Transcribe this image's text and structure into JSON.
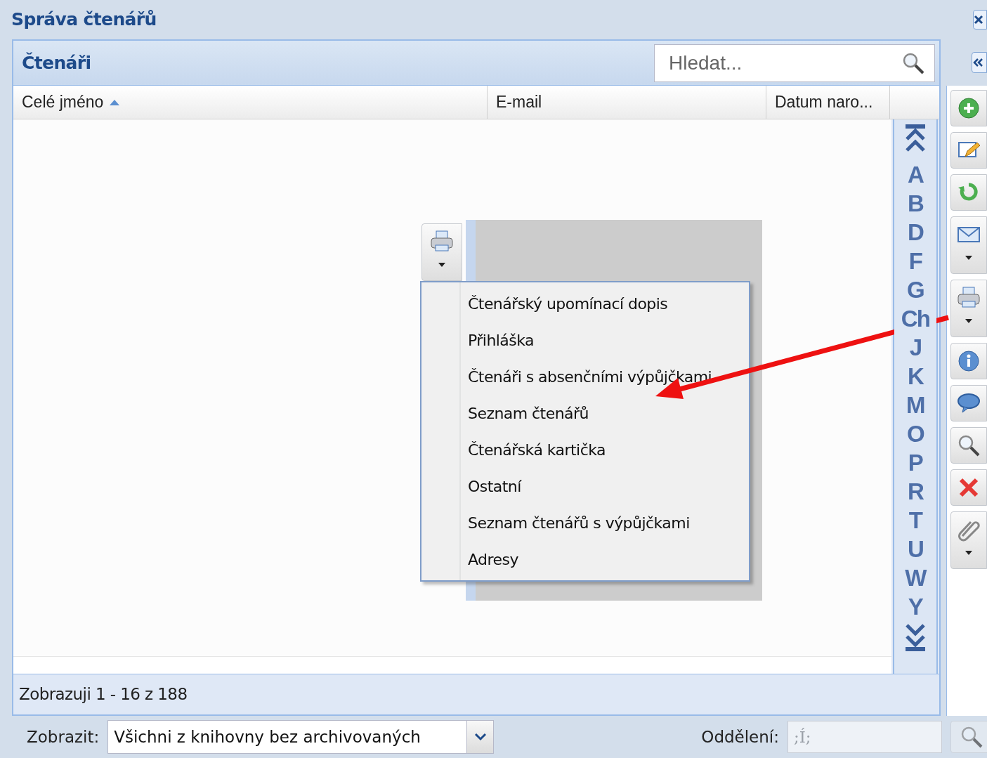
{
  "window": {
    "title": "Správa čtenářů"
  },
  "panel": {
    "title": "Čtenáři",
    "search": {
      "placeholder": "Hledat..."
    }
  },
  "columns": [
    {
      "label": "Celé jméno",
      "sorted": true
    },
    {
      "label": "E-mail",
      "sorted": false
    },
    {
      "label": "Datum naro...",
      "sorted": false
    }
  ],
  "alphabet": [
    "A",
    "B",
    "D",
    "F",
    "G",
    "Ch",
    "J",
    "K",
    "M",
    "O",
    "P",
    "R",
    "T",
    "U",
    "W",
    "Y"
  ],
  "status_bar": {
    "text": "Zobrazuji 1 - 16 z 188"
  },
  "toolbar": [
    {
      "kind": "add",
      "has_menu": false
    },
    {
      "kind": "edit",
      "has_menu": false
    },
    {
      "kind": "refresh",
      "has_menu": false
    },
    {
      "kind": "mail",
      "has_menu": true
    },
    {
      "kind": "print",
      "has_menu": true
    },
    {
      "kind": "info",
      "has_menu": false
    },
    {
      "kind": "comment",
      "has_menu": false
    },
    {
      "kind": "search",
      "has_menu": false
    },
    {
      "kind": "delete",
      "has_menu": false
    },
    {
      "kind": "attach",
      "has_menu": true
    }
  ],
  "print_menu": [
    "Čtenářský upomínací dopis",
    "Přihláška",
    "Čtenáři s absenčními výpůjčkami",
    "Seznam čtenářů",
    "Čtenářská kartička",
    "Ostatní",
    "Seznam čtenářů s výpůjčkami",
    "Adresy"
  ],
  "filter": {
    "label": "Zobrazit:",
    "value": "Všichni z knihovny bez archivovaných"
  },
  "department": {
    "label": "Oddělení:",
    "value": ";Í;",
    "disabled": true
  }
}
